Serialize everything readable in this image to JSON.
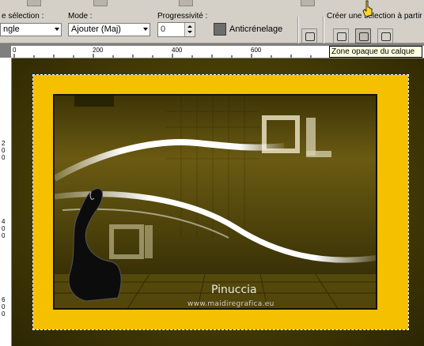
{
  "options": {
    "selection_label": "e sélection :",
    "selection_value": "ngle",
    "mode_label": "Mode :",
    "mode_value": "Ajouter (Maj)",
    "progressivity_label": "Progressivité :",
    "progressivity_value": "0",
    "antialias_label": "Anticrénelage",
    "create_selection_label": "Créer une sélection à partir de"
  },
  "tooltip": "Zone opaque du calque",
  "ruler": {
    "h_marks": [
      "0",
      "200",
      "400",
      "600"
    ],
    "v_marks": [
      "2",
      "0",
      "0",
      "4",
      "0",
      "0",
      "6",
      "0",
      "0"
    ]
  },
  "artwork": {
    "title": "Pinuccia",
    "url": "www.maidiregrafica.eu"
  },
  "colors": {
    "frame": "#f4c000",
    "workspace": "#7f7f7f",
    "tooltip_bg": "#ffffe1"
  }
}
